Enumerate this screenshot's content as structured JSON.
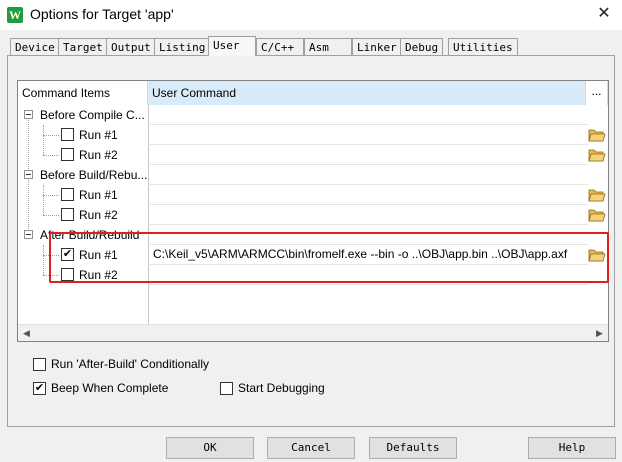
{
  "window": {
    "icon_letter": "W",
    "title": "Options for Target 'app'",
    "close_glyph": "✕"
  },
  "tabs": [
    {
      "label": "Device"
    },
    {
      "label": "Target"
    },
    {
      "label": "Output"
    },
    {
      "label": "Listing"
    },
    {
      "label": "User",
      "active": true
    },
    {
      "label": "C/C++"
    },
    {
      "label": "Asm"
    },
    {
      "label": "Linker"
    },
    {
      "label": "Debug"
    },
    {
      "label": "Utilities"
    }
  ],
  "grid": {
    "col_items": "Command Items",
    "col_command": "User Command",
    "col_more": "...",
    "groups": [
      {
        "label": "Before Compile C...",
        "children": [
          {
            "label": "Run #1",
            "checked": false,
            "command": ""
          },
          {
            "label": "Run #2",
            "checked": false,
            "command": ""
          }
        ]
      },
      {
        "label": "Before Build/Rebu...",
        "children": [
          {
            "label": "Run #1",
            "checked": false,
            "command": ""
          },
          {
            "label": "Run #2",
            "checked": false,
            "command": ""
          }
        ]
      },
      {
        "label": "After Build/Rebuild",
        "children": [
          {
            "label": "Run #1",
            "checked": true,
            "command": "C:\\Keil_v5\\ARM\\ARMCC\\bin\\fromelf.exe --bin -o  ..\\OBJ\\app.bin ..\\OBJ\\app.axf"
          },
          {
            "label": "Run #2",
            "checked": false,
            "command": ""
          }
        ]
      }
    ],
    "browse_icon": "folder-open-icon"
  },
  "options": {
    "run_after_build": {
      "label": "Run 'After-Build' Conditionally",
      "checked": false
    },
    "beep": {
      "label": "Beep When Complete",
      "checked": true
    },
    "start_debugging": {
      "label": "Start Debugging",
      "checked": false
    }
  },
  "buttons": {
    "ok": "OK",
    "cancel": "Cancel",
    "defaults": "Defaults",
    "help": "Help"
  },
  "colors": {
    "header_selected": "#d9ebf9",
    "highlight_box": "#e02020",
    "folder": "#e8b84a"
  }
}
